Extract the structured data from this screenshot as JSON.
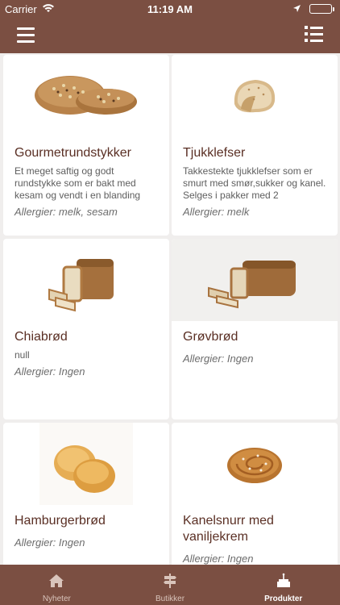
{
  "status": {
    "carrier": "Carrier",
    "time": "11:19 AM"
  },
  "products": [
    {
      "name": "Gourmetrundstykker",
      "description": "Et meget saftig og godt rundstykke som er bakt med kesam og vendt i en blanding",
      "allergy": "Allergier: melk, sesam",
      "image": "bread-rolls-image"
    },
    {
      "name": "Tjukklefser",
      "description": "Takkestekte tjukklefser som er smurt med smør,sukker og kanel. Selges i pakker med 2",
      "allergy": "Allergier: melk",
      "image": "lefse-image"
    },
    {
      "name": "Chiabrød",
      "description": "null",
      "allergy": "Allergier: Ingen",
      "image": "sliced-loaf-image"
    },
    {
      "name": "Grøvbrød",
      "description": "",
      "allergy": "Allergier: Ingen",
      "image": "wholegrain-loaf-image"
    },
    {
      "name": "Hamburgerbrød",
      "description": "",
      "allergy": "Allergier: Ingen",
      "image": "burger-buns-image"
    },
    {
      "name": "Kanelsnurr med vaniljekrem",
      "description": "",
      "allergy": "Allergier: Ingen",
      "image": "cinnamon-roll-image"
    }
  ],
  "tabs": [
    {
      "label": "Nyheter",
      "icon": "home-icon",
      "active": false
    },
    {
      "label": "Butikker",
      "icon": "signpost-icon",
      "active": false
    },
    {
      "label": "Produkter",
      "icon": "cake-icon",
      "active": true
    }
  ],
  "colors": {
    "brand": "#7b4f42",
    "title_text": "#5a2f24",
    "background": "#f0eeed"
  }
}
